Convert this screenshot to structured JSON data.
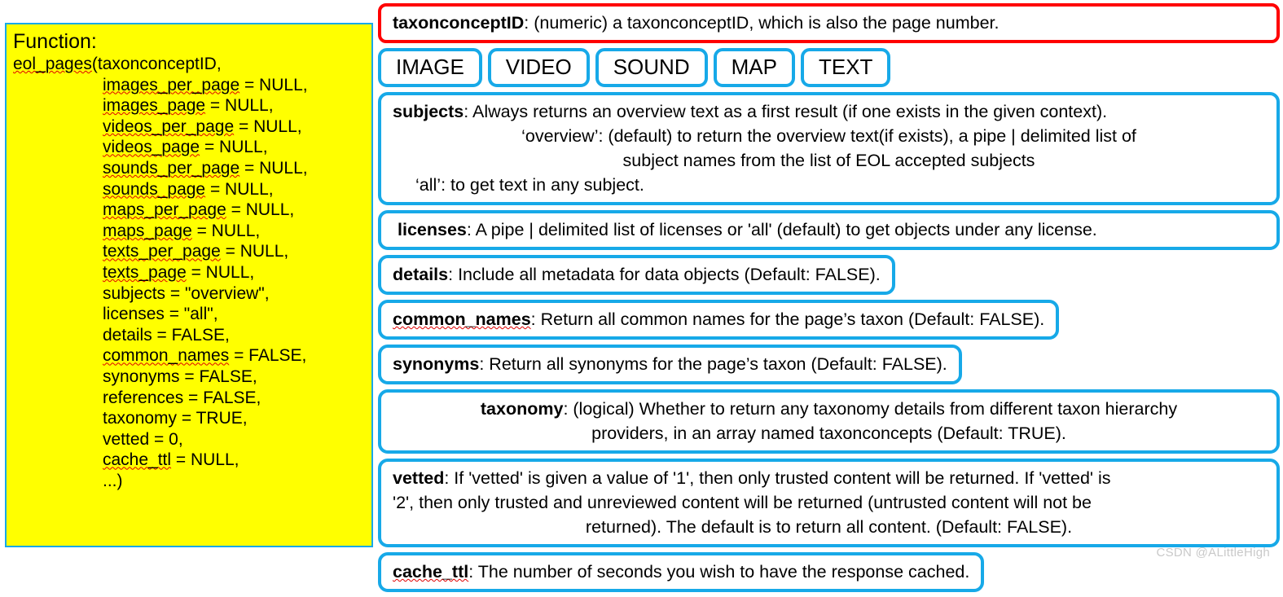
{
  "function_panel": {
    "title": "Function:",
    "signature_lines": [
      {
        "indent": 0,
        "segments": [
          {
            "t": "eol_pages",
            "spell": true
          },
          {
            "t": "(taxonconceptID,",
            "spell": false
          }
        ]
      },
      {
        "indent": 1,
        "segments": [
          {
            "t": "images_per_page",
            "spell": true
          },
          {
            "t": " = NULL,",
            "spell": false
          }
        ]
      },
      {
        "indent": 1,
        "segments": [
          {
            "t": "images_page",
            "spell": true
          },
          {
            "t": " = NULL,",
            "spell": false
          }
        ]
      },
      {
        "indent": 1,
        "segments": [
          {
            "t": "videos_per_page",
            "spell": true
          },
          {
            "t": " = NULL,",
            "spell": false
          }
        ]
      },
      {
        "indent": 1,
        "segments": [
          {
            "t": "videos_page",
            "spell": true
          },
          {
            "t": " = NULL,",
            "spell": false
          }
        ]
      },
      {
        "indent": 1,
        "segments": [
          {
            "t": "sounds_per_page",
            "spell": true
          },
          {
            "t": " = NULL,",
            "spell": false
          }
        ]
      },
      {
        "indent": 1,
        "segments": [
          {
            "t": "sounds_page",
            "spell": true
          },
          {
            "t": " = NULL,",
            "spell": false
          }
        ]
      },
      {
        "indent": 1,
        "segments": [
          {
            "t": "maps_per_page",
            "spell": true
          },
          {
            "t": " = NULL,",
            "spell": false
          }
        ]
      },
      {
        "indent": 1,
        "segments": [
          {
            "t": "maps_page",
            "spell": true
          },
          {
            "t": " = NULL,",
            "spell": false
          }
        ]
      },
      {
        "indent": 1,
        "segments": [
          {
            "t": "texts_per_page",
            "spell": true
          },
          {
            "t": " = NULL,",
            "spell": false
          }
        ]
      },
      {
        "indent": 1,
        "segments": [
          {
            "t": "texts_page",
            "spell": true
          },
          {
            "t": " = NULL,",
            "spell": false
          }
        ]
      },
      {
        "indent": 1,
        "segments": [
          {
            "t": "subjects = \"overview\",",
            "spell": false
          }
        ]
      },
      {
        "indent": 1,
        "segments": [
          {
            "t": "licenses = \"all\",",
            "spell": false
          }
        ]
      },
      {
        "indent": 1,
        "segments": [
          {
            "t": "details = FALSE,",
            "spell": false
          }
        ]
      },
      {
        "indent": 1,
        "segments": [
          {
            "t": "common_names",
            "spell": true
          },
          {
            "t": " = FALSE,",
            "spell": false
          }
        ]
      },
      {
        "indent": 1,
        "segments": [
          {
            "t": "synonyms = FALSE,",
            "spell": false
          }
        ]
      },
      {
        "indent": 1,
        "segments": [
          {
            "t": "references = FALSE,",
            "spell": false
          }
        ]
      },
      {
        "indent": 1,
        "segments": [
          {
            "t": "taxonomy = TRUE,",
            "spell": false
          }
        ]
      },
      {
        "indent": 1,
        "segments": [
          {
            "t": "vetted = 0,",
            "spell": false
          }
        ]
      },
      {
        "indent": 1,
        "segments": [
          {
            "t": "cache_ttl",
            "spell": true
          },
          {
            "t": " = NULL,",
            "spell": false
          }
        ]
      },
      {
        "indent": 1,
        "segments": [
          {
            "t": "...)",
            "spell": false
          }
        ]
      }
    ]
  },
  "params": {
    "taxonconceptID": {
      "name": "taxonconceptID",
      "desc": ": (numeric) a taxonconceptID, which is also the page number."
    },
    "tags": [
      "IMAGE",
      "VIDEO",
      "SOUND",
      "MAP",
      "TEXT"
    ],
    "subjects": {
      "name": "subjects",
      "lines": [
        ": Always returns an overview text as a first result (if one exists in the given context).",
        "‘overview’: (default) to return the overview text(if exists), a pipe | delimited list of",
        "subject names from the list of EOL accepted subjects",
        "‘all’: to get text in any subject."
      ]
    },
    "licenses": {
      "name": "licenses",
      "desc": ": A pipe | delimited list of licenses or 'all' (default) to get objects under any license."
    },
    "details": {
      "name": "details",
      "desc": ": Include all metadata for data objects (Default: FALSE)."
    },
    "common_names": {
      "name": "common_names",
      "desc": ": Return all common names for the page’s taxon (Default: FALSE)."
    },
    "synonyms": {
      "name": "synonyms",
      "desc": ": Return all synonyms for the page’s taxon (Default: FALSE)."
    },
    "taxonomy": {
      "name": "taxonomy",
      "lines": [
        ": (logical) Whether to return any taxonomy details from different taxon hierarchy",
        "providers, in an array named taxonconcepts (Default: TRUE)."
      ]
    },
    "vetted": {
      "name": "vetted",
      "lines": [
        ": If 'vetted' is given a value of '1', then only trusted content will be returned. If 'vetted' is",
        "'2', then only trusted and unreviewed content will be returned (untrusted content will not be",
        "returned). The default is to return all content. (Default: FALSE)."
      ]
    },
    "cache_ttl": {
      "name": "cache_ttl",
      "desc": ": The number of seconds you wish to have the response cached."
    }
  },
  "watermark": "CSDN @ALittleHigh",
  "colors": {
    "accent_blue": "#17a9e8",
    "highlight_red": "#ff0000",
    "panel_yellow": "#ffff00",
    "watermark_gray": "#c9c9c9"
  }
}
